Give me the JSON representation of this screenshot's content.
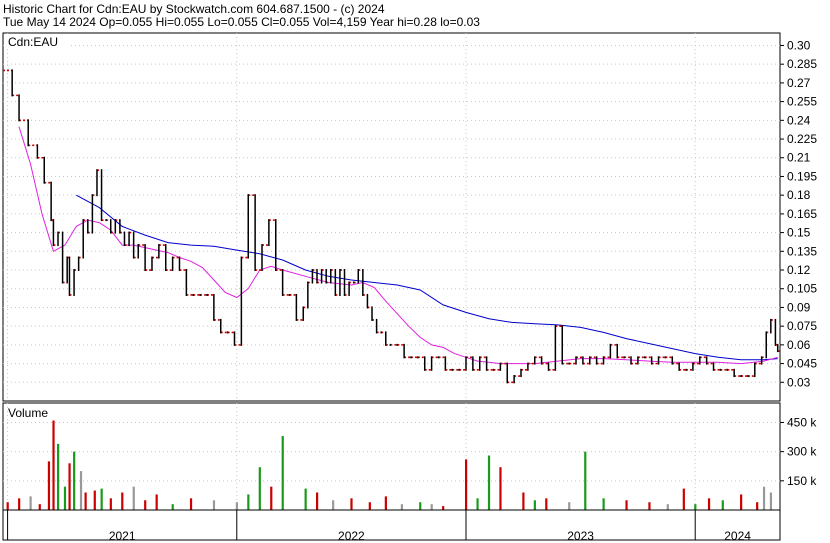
{
  "header": {
    "title": "Historic Chart for Cdn:EAU by Stockwatch.com 604.687.1500 - (c) 2024",
    "quote": "Tue May 14 2024  Op=0.055  Hi=0.055  Lo=0.055  Cl=0.055  Vol=4,159  Year hi=0.28  lo=0.03"
  },
  "chart_data": [
    {
      "type": "line",
      "panel_label": "Cdn:EAU",
      "ylim": [
        0.015,
        0.31
      ],
      "y_ticks": [
        0.03,
        0.045,
        0.06,
        0.075,
        0.09,
        0.105,
        0.12,
        0.135,
        0.15,
        0.165,
        0.18,
        0.195,
        0.21,
        0.225,
        0.24,
        0.255,
        0.27,
        0.285,
        0.3
      ],
      "y_tick_labels": [
        "0.03",
        "0.045",
        "0.06",
        "0.075",
        "0.09",
        "0.105",
        "0.12",
        "0.135",
        "0.15",
        "0.165",
        "0.18",
        "0.195",
        "0.21",
        "0.225",
        "0.24",
        "0.255",
        "0.27",
        "0.285",
        "0.30"
      ],
      "x_range": [
        2020.98,
        2024.37
      ],
      "grid": true,
      "colors": {
        "price": "#000000",
        "no_trade": "#cc0000",
        "ma_long": "#0000cc",
        "ma_short": "#e020e0"
      },
      "price": {
        "x": [
          2020.98,
          2021.02,
          2021.05,
          2021.09,
          2021.13,
          2021.16,
          2021.19,
          2021.2,
          2021.22,
          2021.24,
          2021.26,
          2021.27,
          2021.29,
          2021.31,
          2021.33,
          2021.35,
          2021.37,
          2021.39,
          2021.41,
          2021.43,
          2021.45,
          2021.47,
          2021.49,
          2021.51,
          2021.53,
          2021.55,
          2021.57,
          2021.6,
          2021.63,
          2021.66,
          2021.69,
          2021.72,
          2021.75,
          2021.78,
          2021.81,
          2021.84,
          2021.87,
          2021.9,
          2021.93,
          2021.96,
          2021.99,
          2022.02,
          2022.05,
          2022.08,
          2022.11,
          2022.14,
          2022.17,
          2022.2,
          2022.23,
          2022.26,
          2022.29,
          2022.31,
          2022.33,
          2022.35,
          2022.37,
          2022.39,
          2022.41,
          2022.43,
          2022.45,
          2022.47,
          2022.49,
          2022.51,
          2022.53,
          2022.55,
          2022.57,
          2022.59,
          2022.61,
          2022.63,
          2022.65,
          2022.67,
          2022.7,
          2022.73,
          2022.76,
          2022.79,
          2022.82,
          2022.85,
          2022.88,
          2022.91,
          2022.94,
          2022.97,
          2023.0,
          2023.03,
          2023.06,
          2023.09,
          2023.12,
          2023.15,
          2023.18,
          2023.21,
          2023.24,
          2023.27,
          2023.3,
          2023.33,
          2023.36,
          2023.39,
          2023.42,
          2023.45,
          2023.48,
          2023.51,
          2023.54,
          2023.57,
          2023.6,
          2023.63,
          2023.66,
          2023.69,
          2023.72,
          2023.75,
          2023.78,
          2023.81,
          2023.84,
          2023.87,
          2023.9,
          2023.93,
          2023.96,
          2023.99,
          2024.02,
          2024.05,
          2024.08,
          2024.11,
          2024.14,
          2024.17,
          2024.2,
          2024.23,
          2024.26,
          2024.29,
          2024.31,
          2024.33,
          2024.35,
          2024.36
        ],
        "y": [
          0.28,
          0.26,
          0.24,
          0.22,
          0.21,
          0.19,
          0.16,
          0.14,
          0.15,
          0.11,
          0.13,
          0.1,
          0.12,
          0.13,
          0.16,
          0.15,
          0.18,
          0.2,
          0.16,
          0.16,
          0.15,
          0.16,
          0.15,
          0.14,
          0.15,
          0.13,
          0.14,
          0.12,
          0.13,
          0.14,
          0.12,
          0.13,
          0.12,
          0.1,
          0.1,
          0.1,
          0.1,
          0.08,
          0.07,
          0.07,
          0.06,
          0.13,
          0.18,
          0.12,
          0.14,
          0.16,
          0.12,
          0.1,
          0.1,
          0.08,
          0.09,
          0.11,
          0.12,
          0.11,
          0.12,
          0.11,
          0.12,
          0.1,
          0.12,
          0.1,
          0.11,
          0.11,
          0.12,
          0.1,
          0.09,
          0.08,
          0.07,
          0.07,
          0.06,
          0.06,
          0.06,
          0.05,
          0.05,
          0.05,
          0.04,
          0.05,
          0.05,
          0.04,
          0.04,
          0.04,
          0.05,
          0.04,
          0.05,
          0.04,
          0.04,
          0.045,
          0.03,
          0.035,
          0.04,
          0.045,
          0.05,
          0.045,
          0.04,
          0.075,
          0.045,
          0.045,
          0.05,
          0.045,
          0.05,
          0.045,
          0.05,
          0.06,
          0.05,
          0.05,
          0.045,
          0.05,
          0.05,
          0.045,
          0.05,
          0.05,
          0.045,
          0.04,
          0.04,
          0.045,
          0.05,
          0.045,
          0.04,
          0.04,
          0.04,
          0.035,
          0.035,
          0.035,
          0.045,
          0.05,
          0.07,
          0.08,
          0.06,
          0.055
        ]
      },
      "ma_long": {
        "x": [
          2021.3,
          2021.4,
          2021.5,
          2021.6,
          2021.7,
          2021.8,
          2021.9,
          2022.0,
          2022.1,
          2022.2,
          2022.3,
          2022.4,
          2022.5,
          2022.6,
          2022.7,
          2022.8,
          2022.9,
          2023.0,
          2023.1,
          2023.2,
          2023.3,
          2023.4,
          2023.5,
          2023.6,
          2023.7,
          2023.8,
          2023.9,
          2024.0,
          2024.1,
          2024.2,
          2024.3,
          2024.36
        ],
        "y": [
          0.18,
          0.17,
          0.155,
          0.148,
          0.142,
          0.14,
          0.139,
          0.136,
          0.133,
          0.128,
          0.12,
          0.115,
          0.112,
          0.11,
          0.108,
          0.104,
          0.092,
          0.086,
          0.081,
          0.078,
          0.077,
          0.076,
          0.074,
          0.07,
          0.065,
          0.061,
          0.057,
          0.053,
          0.05,
          0.048,
          0.048,
          0.049
        ]
      },
      "ma_short": {
        "x": [
          2021.05,
          2021.1,
          2021.15,
          2021.2,
          2021.25,
          2021.3,
          2021.35,
          2021.4,
          2021.45,
          2021.5,
          2021.55,
          2021.6,
          2021.65,
          2021.7,
          2021.75,
          2021.8,
          2021.85,
          2021.9,
          2021.95,
          2022.0,
          2022.05,
          2022.1,
          2022.15,
          2022.2,
          2022.3,
          2022.4,
          2022.5,
          2022.55,
          2022.6,
          2022.65,
          2022.7,
          2022.75,
          2022.8,
          2022.85,
          2022.9,
          2022.95,
          2023.0,
          2023.05,
          2023.1,
          2023.15,
          2023.2,
          2023.3,
          2023.4,
          2023.5,
          2023.6,
          2023.7,
          2023.8,
          2023.9,
          2024.0,
          2024.1,
          2024.2,
          2024.3,
          2024.36
        ],
        "y": [
          0.235,
          0.205,
          0.165,
          0.135,
          0.14,
          0.155,
          0.16,
          0.158,
          0.152,
          0.14,
          0.14,
          0.138,
          0.136,
          0.134,
          0.13,
          0.127,
          0.122,
          0.112,
          0.102,
          0.098,
          0.105,
          0.12,
          0.123,
          0.12,
          0.115,
          0.11,
          0.108,
          0.11,
          0.106,
          0.095,
          0.085,
          0.075,
          0.066,
          0.06,
          0.058,
          0.053,
          0.05,
          0.047,
          0.046,
          0.045,
          0.045,
          0.045,
          0.047,
          0.049,
          0.049,
          0.048,
          0.047,
          0.046,
          0.046,
          0.046,
          0.045,
          0.047,
          0.05
        ]
      }
    },
    {
      "type": "bar",
      "panel_label": "Volume",
      "ylim": [
        0,
        550000
      ],
      "y_ticks": [
        150000,
        300000,
        450000
      ],
      "y_tick_labels": [
        "150 k",
        "300 k",
        "450 k"
      ],
      "series_colors": {
        "up": "#1a9a1a",
        "down": "#cc0000",
        "unchanged": "#999999"
      },
      "x": [
        2021.0,
        2021.05,
        2021.1,
        2021.14,
        2021.18,
        2021.2,
        2021.22,
        2021.25,
        2021.27,
        2021.29,
        2021.32,
        2021.34,
        2021.38,
        2021.41,
        2021.45,
        2021.5,
        2021.55,
        2021.6,
        2021.65,
        2021.72,
        2021.8,
        2021.9,
        2022.0,
        2022.05,
        2022.1,
        2022.15,
        2022.2,
        2022.3,
        2022.35,
        2022.42,
        2022.5,
        2022.58,
        2022.65,
        2022.72,
        2022.8,
        2022.85,
        2022.9,
        2023.0,
        2023.05,
        2023.1,
        2023.15,
        2023.25,
        2023.3,
        2023.35,
        2023.45,
        2023.52,
        2023.6,
        2023.7,
        2023.8,
        2023.88,
        2023.95,
        2024.0,
        2024.06,
        2024.12,
        2024.2,
        2024.27,
        2024.3,
        2024.33
      ],
      "values": [
        40000,
        60000,
        70000,
        30000,
        250000,
        460000,
        340000,
        120000,
        240000,
        300000,
        200000,
        90000,
        100000,
        110000,
        60000,
        90000,
        120000,
        50000,
        80000,
        30000,
        60000,
        50000,
        40000,
        80000,
        220000,
        120000,
        380000,
        110000,
        90000,
        50000,
        60000,
        40000,
        70000,
        30000,
        40000,
        30000,
        20000,
        260000,
        60000,
        280000,
        220000,
        90000,
        50000,
        60000,
        40000,
        300000,
        60000,
        50000,
        40000,
        30000,
        110000,
        30000,
        60000,
        50000,
        80000,
        40000,
        120000,
        90000
      ],
      "direction": [
        "down",
        "down",
        "unchanged",
        "down",
        "down",
        "down",
        "up",
        "up",
        "down",
        "up",
        "unchanged",
        "down",
        "down",
        "up",
        "down",
        "down",
        "unchanged",
        "down",
        "down",
        "up",
        "down",
        "unchanged",
        "unchanged",
        "up",
        "up",
        "down",
        "up",
        "up",
        "down",
        "unchanged",
        "down",
        "down",
        "down",
        "unchanged",
        "up",
        "unchanged",
        "down",
        "down",
        "up",
        "up",
        "down",
        "down",
        "up",
        "down",
        "unchanged",
        "up",
        "up",
        "down",
        "down",
        "unchanged",
        "down",
        "up",
        "down",
        "up",
        "down",
        "down",
        "unchanged",
        "unchanged"
      ],
      "x_labels": [
        "2021",
        "2022",
        "2023",
        "2024"
      ],
      "x_dividers": [
        2021.0,
        2022.0,
        2023.0,
        2024.0
      ]
    }
  ]
}
